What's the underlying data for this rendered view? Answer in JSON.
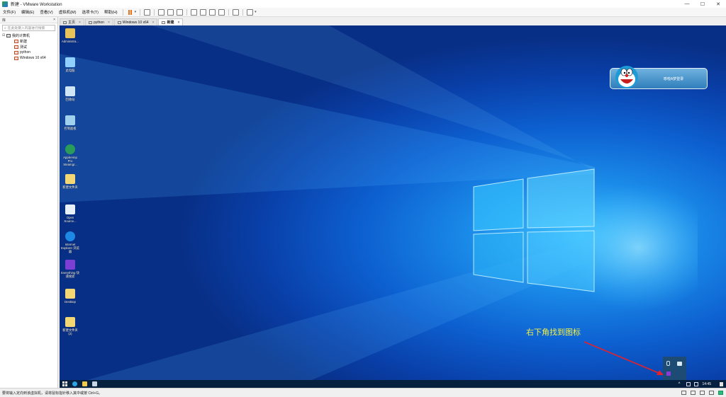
{
  "window": {
    "title": "新建 - VMware Workstation",
    "minimize": "—",
    "maximize": "☐",
    "close": "✕"
  },
  "menu": [
    "文件(F)",
    "编辑(E)",
    "查看(V)",
    "虚拟机(M)",
    "选项卡(T)",
    "帮助(H)"
  ],
  "library": {
    "title": "库",
    "close": "×",
    "search_placeholder": "在此处键入内容进行搜索",
    "root": "我的计算机",
    "items": [
      "新建",
      "测试",
      "python",
      "Windows 10 x64"
    ]
  },
  "tabs": [
    {
      "label": "主页",
      "active": false
    },
    {
      "label": "python",
      "active": false
    },
    {
      "label": "Windows 10 x64",
      "active": false
    },
    {
      "label": "新建",
      "active": true
    }
  ],
  "desktop_icons": [
    {
      "label": "Administra...",
      "icon": "user-folder-icon",
      "color": "#e7c15a"
    },
    {
      "label": "此电脑",
      "icon": "this-pc-icon",
      "color": "#8fd0ff"
    },
    {
      "label": "回收站",
      "icon": "recycle-bin-icon",
      "color": "#cfe6f7"
    },
    {
      "label": "控制面板",
      "icon": "control-panel-icon",
      "color": "#9fd1ef"
    },
    {
      "label": "AppleAmp Pro Steamgr...",
      "icon": "media-player-icon",
      "color": "#2a9c5a"
    },
    {
      "label": "新建文件夹",
      "icon": "folder-icon",
      "color": "#f3d774"
    },
    {
      "label": "Open Source...",
      "icon": "mail-icon",
      "color": "#e8f1fa"
    },
    {
      "label": "Internet Explorer 浏览器",
      "icon": "ie-icon",
      "color": "#1e88e5"
    },
    {
      "label": "Everything 快速搜索",
      "icon": "search-app-icon",
      "color": "#7b3fd6"
    },
    {
      "label": "Desktop",
      "icon": "folder-icon",
      "color": "#f3d774"
    },
    {
      "label": "新建文件夹 (2)",
      "icon": "folder-icon",
      "color": "#f3d774"
    }
  ],
  "toast": {
    "text": "哆啦A梦登录"
  },
  "annotation": {
    "text": "右下角找到图标"
  },
  "taskbar": {
    "clock": "14:45",
    "chevron": "^"
  },
  "status": {
    "text": "要将输入定向到该虚拟机，请将鼠标指针移入其中或按 Ctrl+G。"
  },
  "colors": {
    "annotation": "#f6f146",
    "arrow": "#e8202a",
    "desktop_bg": "#0d5fd0"
  }
}
